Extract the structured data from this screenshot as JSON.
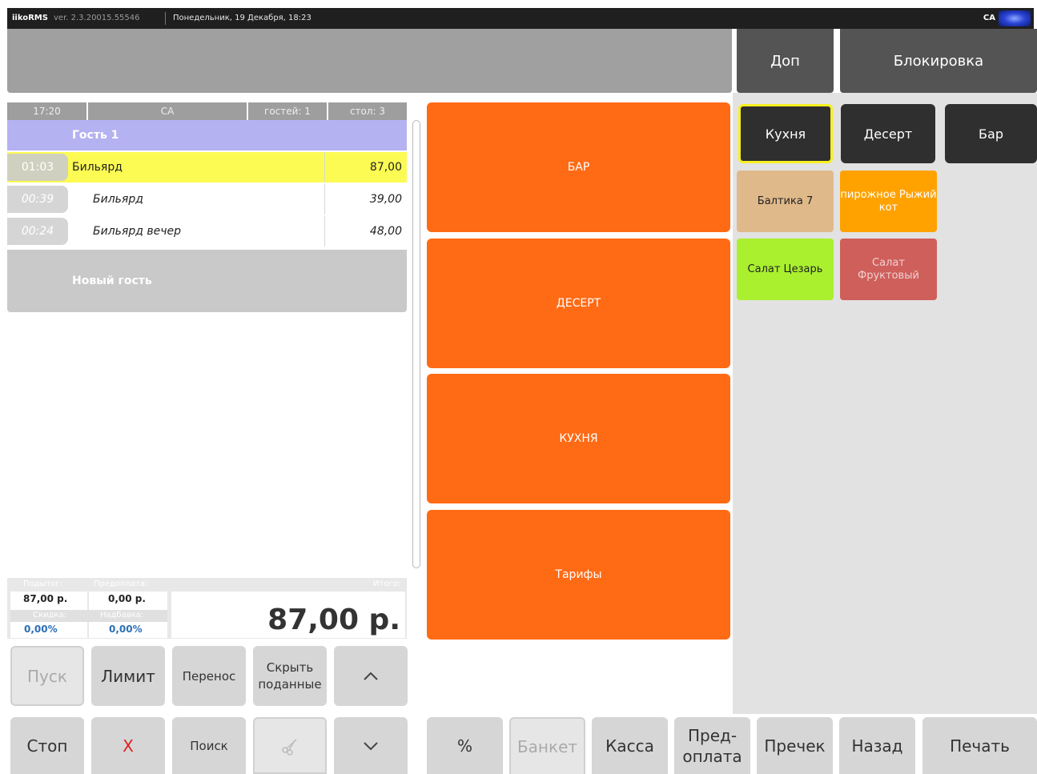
{
  "status_bar": {
    "app_name": "iikoRMS",
    "version": "ver. 2.3.20015.55546",
    "datetime": "Понедельник, 19 Декабря, 18:23",
    "user": "СА"
  },
  "top_buttons": {
    "dop": "Доп",
    "lock": "Блокировка"
  },
  "order_header": {
    "time": "17:20",
    "waiter": "СА",
    "guests": "гостей: 1",
    "table": "стол: 3"
  },
  "guest_label": "Гость 1",
  "order_items": [
    {
      "time": "01:03",
      "name": "Бильярд",
      "price": "87,00"
    },
    {
      "time": "00:39",
      "name": "Бильярд",
      "price": "39,00"
    },
    {
      "time": "00:24",
      "name": "Бильярд вечер",
      "price": "48,00"
    }
  ],
  "new_guest": "Новый гость",
  "totals": {
    "subtotal_label": "Подытог:",
    "subtotal": "87,00 р.",
    "prepay_label": "Предоплата:",
    "prepay": "0,00 р.",
    "discount_label": "Скидка:",
    "discount": "0,00%",
    "surcharge_label": "Надбавка:",
    "surcharge": "0,00%",
    "total_label": "Итого:",
    "total": "87,00 р."
  },
  "left_buttons": {
    "start": "Пуск",
    "limit": "Лимит",
    "transfer": "Перенос",
    "hide_served": "Скрыть поданные",
    "stop": "Стоп",
    "delete": "X",
    "search": "Поиск"
  },
  "categories": [
    "БАР",
    "ДЕСЕРТ",
    "КУХНЯ",
    "Тарифы"
  ],
  "menu_tabs": [
    "Кухня",
    "Десерт",
    "Бар"
  ],
  "products": [
    {
      "name": "Балтика 7",
      "color": "#e0b98a"
    },
    {
      "name": "пирожное Рыжий кот",
      "color": "#ffa200"
    },
    {
      "name": "Салат Цезарь",
      "color": "#aaf02f"
    },
    {
      "name": "Салат Фруктовый",
      "color": "#cf5f5b"
    }
  ],
  "bottom_buttons": {
    "percent": "%",
    "banquet": "Банкет",
    "cash": "Касса",
    "prepay": "Пред-оплата",
    "precheck": "Пречек",
    "back": "Назад",
    "print": "Печать"
  },
  "colors": {
    "accent_orange": "#ff6a15",
    "selected_row": "#fcfb53",
    "guest_header": "#b5b2f2"
  }
}
